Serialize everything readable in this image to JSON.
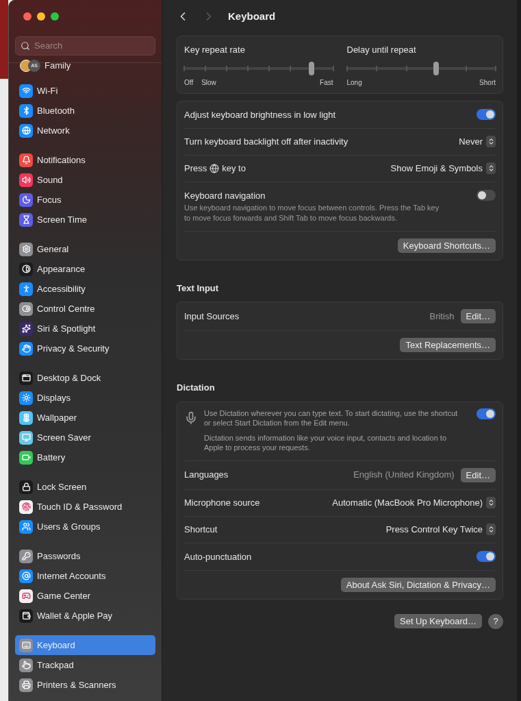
{
  "sidebar": {
    "search": {
      "placeholder": "Search"
    },
    "account": {
      "initials": "AS",
      "label": "Family"
    },
    "groups": [
      {
        "items": [
          {
            "label": "Wi-Fi",
            "color": "#1a8cff",
            "selected": false
          },
          {
            "label": "Bluetooth",
            "color": "#1a8cff",
            "selected": false
          },
          {
            "label": "Network",
            "color": "#1a8cff",
            "selected": false
          }
        ]
      },
      {
        "items": [
          {
            "label": "Notifications",
            "color": "#f04a43",
            "selected": false
          },
          {
            "label": "Sound",
            "color": "#f0385a",
            "selected": false
          },
          {
            "label": "Focus",
            "color": "#5e5ce6",
            "selected": false
          },
          {
            "label": "Screen Time",
            "color": "#5e5ce6",
            "selected": false
          }
        ]
      },
      {
        "items": [
          {
            "label": "General",
            "color": "#8e8e93",
            "selected": false
          },
          {
            "label": "Appearance",
            "color": "#1c1c1e",
            "selected": false
          },
          {
            "label": "Accessibility",
            "color": "#1a8cff",
            "selected": false
          },
          {
            "label": "Control Centre",
            "color": "#8e8e93",
            "selected": false
          },
          {
            "label": "Siri & Spotlight",
            "color": "#3a2a6a",
            "selected": false
          },
          {
            "label": "Privacy & Security",
            "color": "#1a8cff",
            "selected": false
          }
        ]
      },
      {
        "items": [
          {
            "label": "Desktop & Dock",
            "color": "#1c1c1e",
            "selected": false
          },
          {
            "label": "Displays",
            "color": "#1a8cff",
            "selected": false
          },
          {
            "label": "Wallpaper",
            "color": "#4fc3f7",
            "selected": false
          },
          {
            "label": "Screen Saver",
            "color": "#64c8ea",
            "selected": false
          },
          {
            "label": "Battery",
            "color": "#34c759",
            "selected": false
          }
        ]
      },
      {
        "items": [
          {
            "label": "Lock Screen",
            "color": "#1c1c1e",
            "selected": false
          },
          {
            "label": "Touch ID & Password",
            "color": "#f2f2f2",
            "selected": false
          },
          {
            "label": "Users & Groups",
            "color": "#1a8cff",
            "selected": false
          }
        ]
      },
      {
        "items": [
          {
            "label": "Passwords",
            "color": "#8e8e93",
            "selected": false
          },
          {
            "label": "Internet Accounts",
            "color": "#1a8cff",
            "selected": false
          },
          {
            "label": "Game Center",
            "color": "#f2f2f2",
            "selected": false
          },
          {
            "label": "Wallet & Apple Pay",
            "color": "#1c1c1e",
            "selected": false
          }
        ]
      },
      {
        "items": [
          {
            "label": "Keyboard",
            "color": "#8e8e93",
            "selected": true
          },
          {
            "label": "Trackpad",
            "color": "#8e8e93",
            "selected": false
          },
          {
            "label": "Printers & Scanners",
            "color": "#8e8e93",
            "selected": false
          }
        ]
      }
    ]
  },
  "header": {
    "title": "Keyboard",
    "back_enabled": true,
    "forward_enabled": false
  },
  "sliders": [
    {
      "label": "Key repeat rate",
      "level": 0.857,
      "start_labels": [
        "Off",
        "Slow"
      ],
      "end_label": "Fast"
    },
    {
      "label": "Delay until repeat",
      "level": 0.6,
      "start_labels": [
        "Long"
      ],
      "end_label": "Short"
    }
  ],
  "sections": [
    {
      "rows": [
        {
          "kind": "toggle",
          "label": "Adjust keyboard brightness in low light",
          "on": true
        },
        {
          "kind": "popup",
          "label": "Turn keyboard backlight off after inactivity",
          "value": "Never"
        },
        {
          "kind": "popup",
          "label": "Press",
          "label_after": "key to",
          "value": "Show Emoji & Symbols"
        },
        {
          "kind": "toggle",
          "label": "Keyboard navigation",
          "description": "Use keyboard navigation to move focus between controls. Press the Tab key to move focus forwards and Shift Tab to move focus backwards.",
          "on": false
        },
        {
          "kind": "button",
          "button": "Keyboard Shortcuts…"
        }
      ]
    },
    {
      "heading": "Text Input",
      "rows": [
        {
          "kind": "value_button",
          "label": "Input Sources",
          "value": "British",
          "button": "Edit…"
        },
        {
          "kind": "button",
          "button": "Text Replacements…"
        }
      ]
    },
    {
      "heading": "Dictation",
      "rows": [
        {
          "kind": "dictation",
          "paragraphs": [
            "Use Dictation wherever you can type text. To start dictating, use the shortcut or select Start Dictation from the Edit menu.",
            "Dictation sends information like your voice input, contacts and location to Apple to process your requests."
          ],
          "on": true
        },
        {
          "kind": "value_button",
          "label": "Languages",
          "value": "English (United Kingdom)",
          "button": "Edit…"
        },
        {
          "kind": "popup",
          "label": "Microphone source",
          "value": "Automatic (MacBook Pro Microphone)"
        },
        {
          "kind": "popup",
          "label": "Shortcut",
          "value": "Press Control Key Twice"
        },
        {
          "kind": "toggle",
          "label": "Auto-punctuation",
          "on": true
        },
        {
          "kind": "button",
          "button": "About Ask Siri, Dictation & Privacy…"
        }
      ]
    }
  ],
  "footer": {
    "button": "Set Up Keyboard…",
    "help": "?"
  }
}
